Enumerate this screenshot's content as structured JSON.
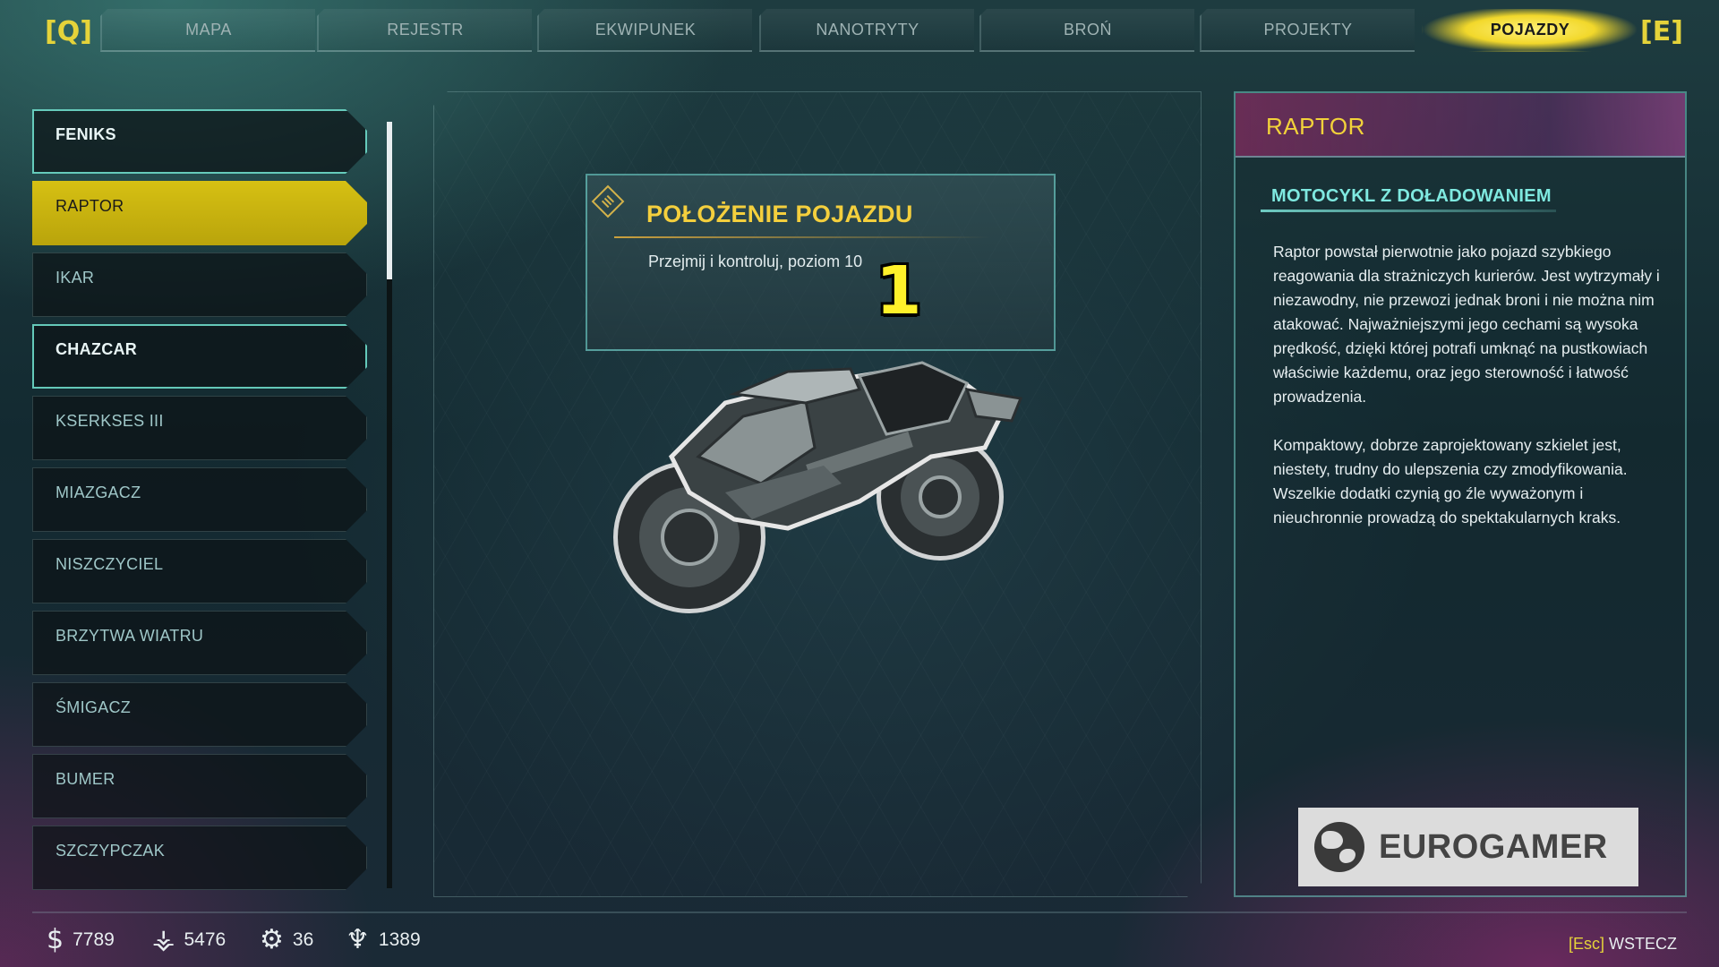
{
  "tabs": {
    "prev_key": "[Q]",
    "next_key": "[E]",
    "items": [
      "MAPA",
      "REJESTR",
      "EKWIPUNEK",
      "NANOTRYTY",
      "BROŃ",
      "PROJEKTY",
      "POJAZDY"
    ],
    "active": "POJAZDY"
  },
  "vehicles": [
    "FENIKS",
    "RAPTOR",
    "IKAR",
    "CHAZCAR",
    "KSERKSES III",
    "MIAZGACZ",
    "NISZCZYCIEL",
    "BRZYTWA WIATRU",
    "ŚMIGACZ",
    "BUMER",
    "SZCZYPCZAK"
  ],
  "selected_vehicle": "RAPTOR",
  "location": {
    "title": "POŁOŻENIE POJAZDU",
    "description": "Przejmij i kontroluj, poziom 10",
    "annotation": "1"
  },
  "info": {
    "title": "RAPTOR",
    "subtitle": "MOTOCYKL Z DOŁADOWANIEM",
    "paragraph1": "Raptor powstał pierwotnie jako pojazd szybkiego reagowania dla strażniczych kurierów. Jest wytrzymały i niezawodny, nie przewozi jednak broni i nie można nim atakować. Najważniejszymi jego cechami są wysoka prędkość, dzięki której potrafi umknąć na pustkowiach właściwie każdemu, oraz jego sterowność i łatwość prowadzenia.",
    "paragraph2": "Kompaktowy, dobrze zaprojektowany szkielet jest, niestety, trudny do ulepszenia czy zmodyfikowania. Wszelkie dodatki czynią go źle wyważonym i nieuchronnie prowadzą do spektakularnych kraks."
  },
  "watermark": "EUROGAMER",
  "resources": {
    "money": "7789",
    "feltrite": "5476",
    "parts": "36",
    "ark": "1389"
  },
  "back": {
    "key": "[Esc]",
    "label": "WSTECZ"
  },
  "colors": {
    "accent_yellow": "#f2d82b",
    "accent_cyan": "#7fe9e0",
    "header_magenta": "#aa286e"
  }
}
